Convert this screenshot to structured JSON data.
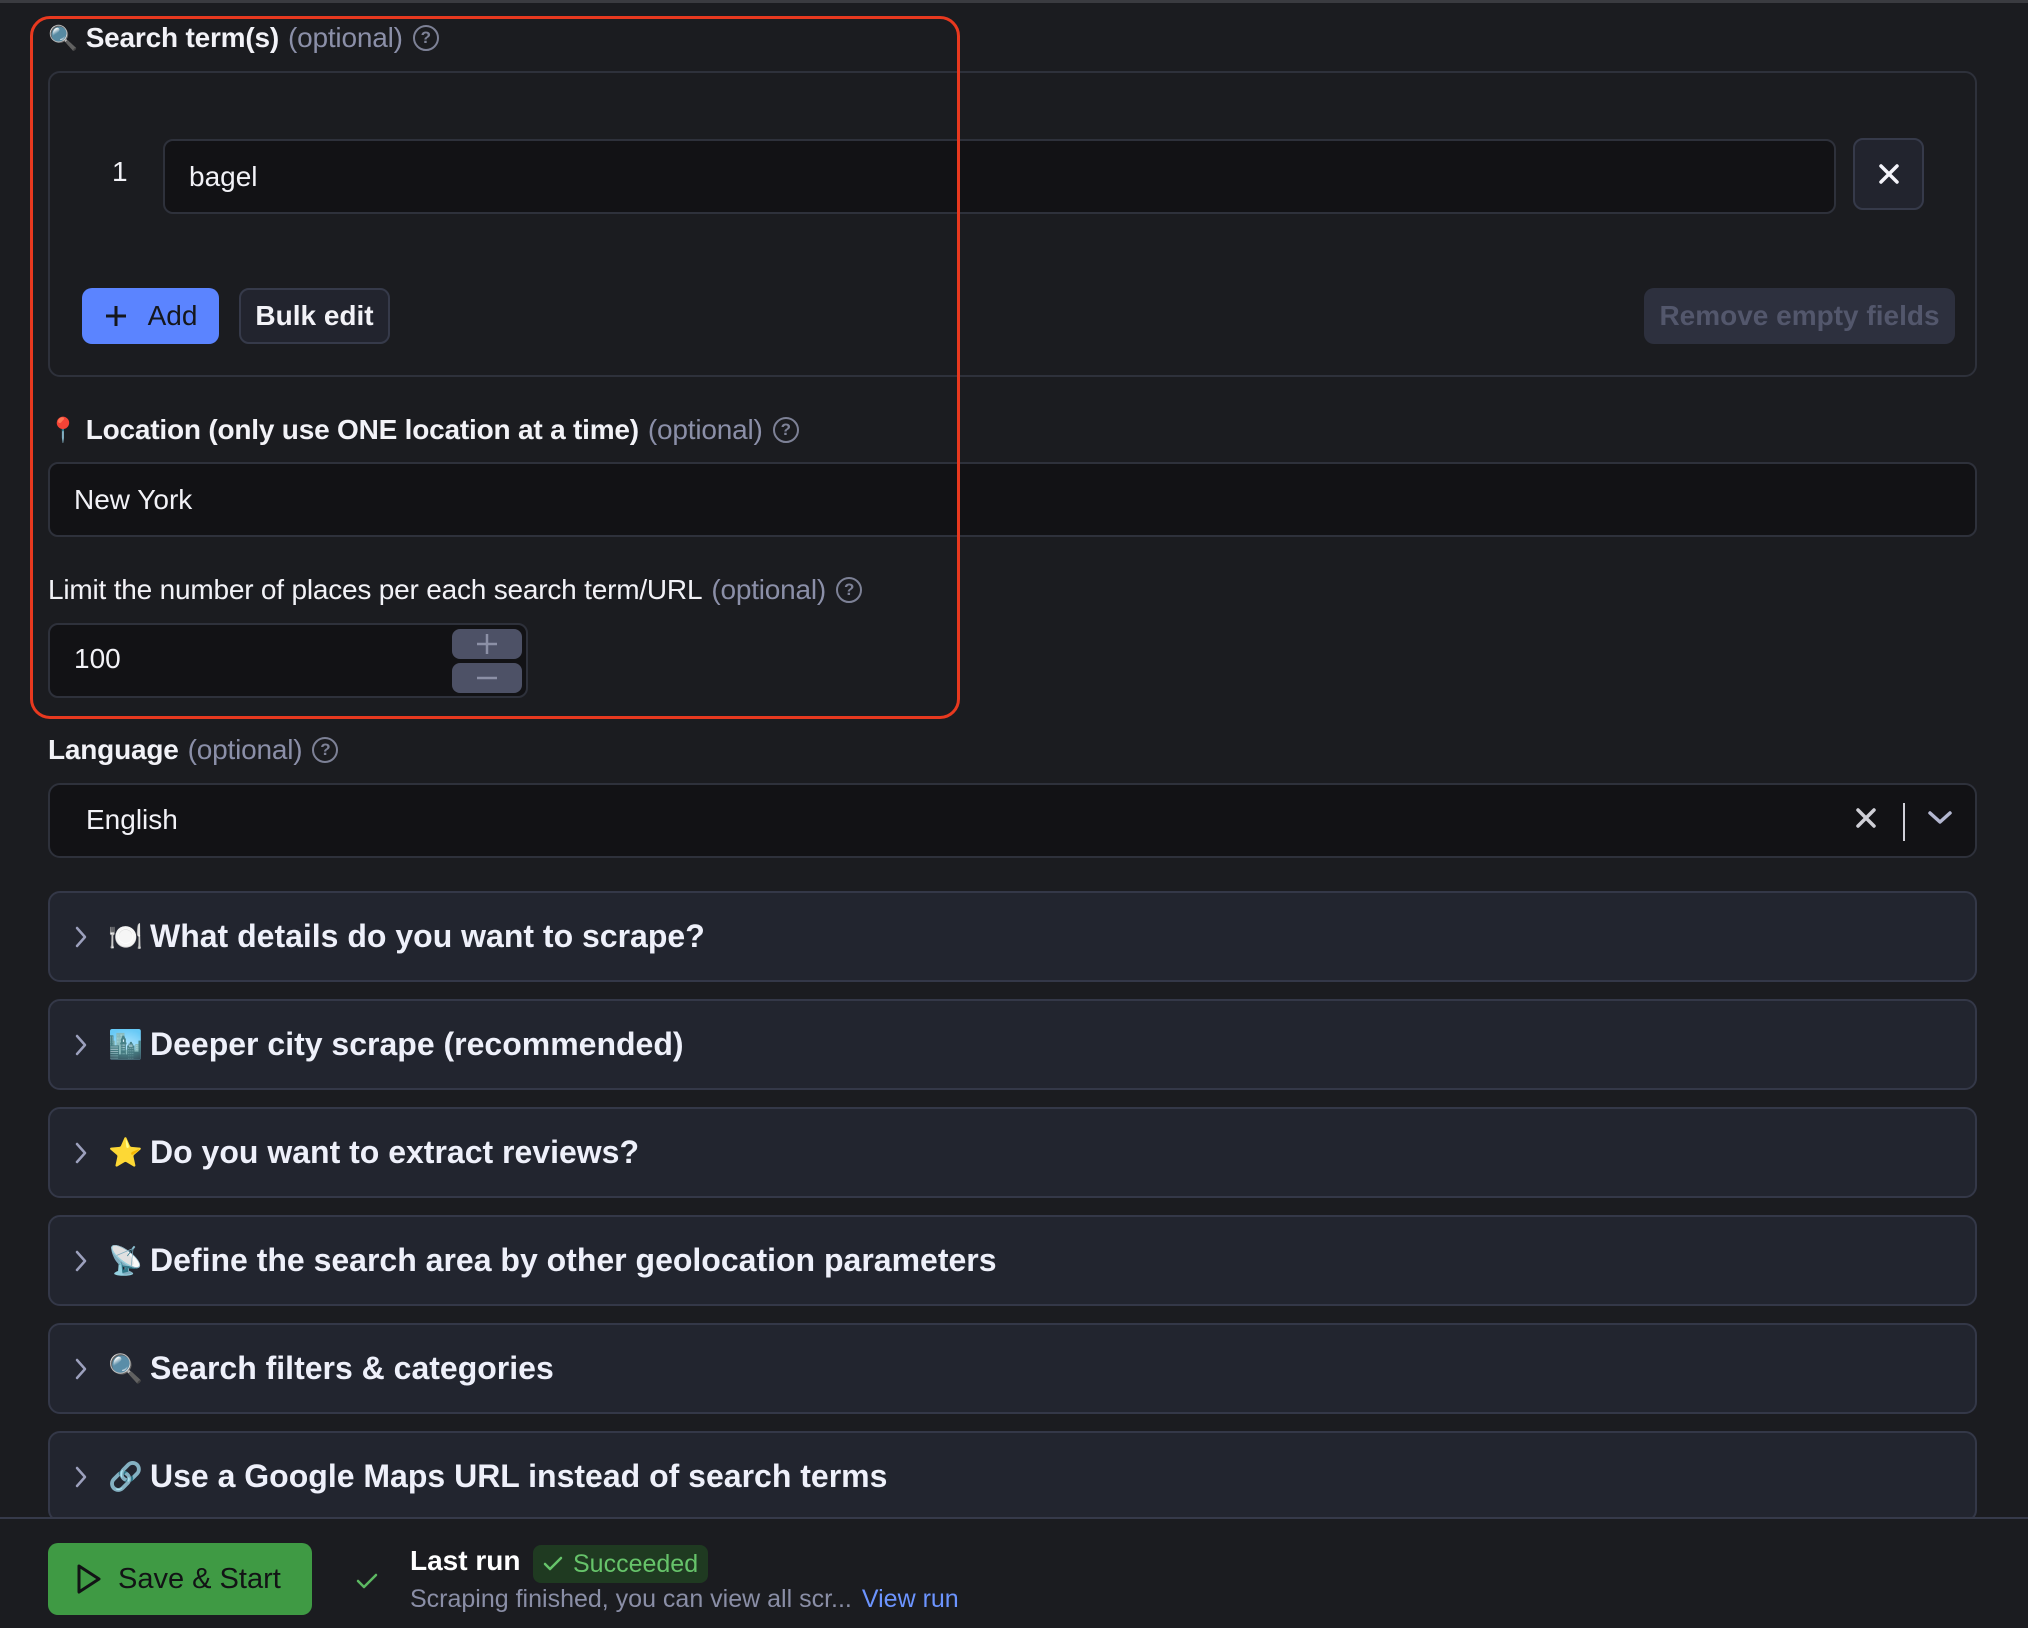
{
  "search_terms": {
    "emoji": "🔍",
    "label": "Search term(s)",
    "optional": "(optional)",
    "help": "?",
    "items": [
      {
        "index": "1",
        "value": "bagel"
      }
    ],
    "add_label": "Add",
    "bulk_edit_label": "Bulk edit",
    "remove_empty_label": "Remove empty fields"
  },
  "location": {
    "emoji": "📍",
    "label": "Location (only use ONE location at a time)",
    "optional": "(optional)",
    "help": "?",
    "value": "New York"
  },
  "limit": {
    "label": "Limit the number of places per each search term/URL",
    "optional": "(optional)",
    "help": "?",
    "value": "100"
  },
  "language": {
    "label": "Language",
    "optional": "(optional)",
    "help": "?",
    "value": "English"
  },
  "sections": [
    {
      "emoji": "🍽️",
      "title": "What details do you want to scrape?"
    },
    {
      "emoji": "🏙️",
      "title": "Deeper city scrape (recommended)"
    },
    {
      "emoji": "⭐",
      "title": "Do you want to extract reviews?"
    },
    {
      "emoji": "📡",
      "title": "Define the search area by other geolocation parameters"
    },
    {
      "emoji": "🔍",
      "title": "Search filters & categories"
    },
    {
      "emoji": "🔗",
      "title": "Use a Google Maps URL instead of search terms"
    }
  ],
  "footer": {
    "save_start_label": "Save & Start",
    "last_run_label": "Last run",
    "status": "Succeeded",
    "description": "Scraping finished, you can view all scr...",
    "view_run_label": "View run"
  },
  "colors": {
    "highlight": "#e8391f",
    "primary": "#5b84ff",
    "success": "#3f9a44",
    "success_text": "#66c36a",
    "link": "#6c94ff"
  }
}
